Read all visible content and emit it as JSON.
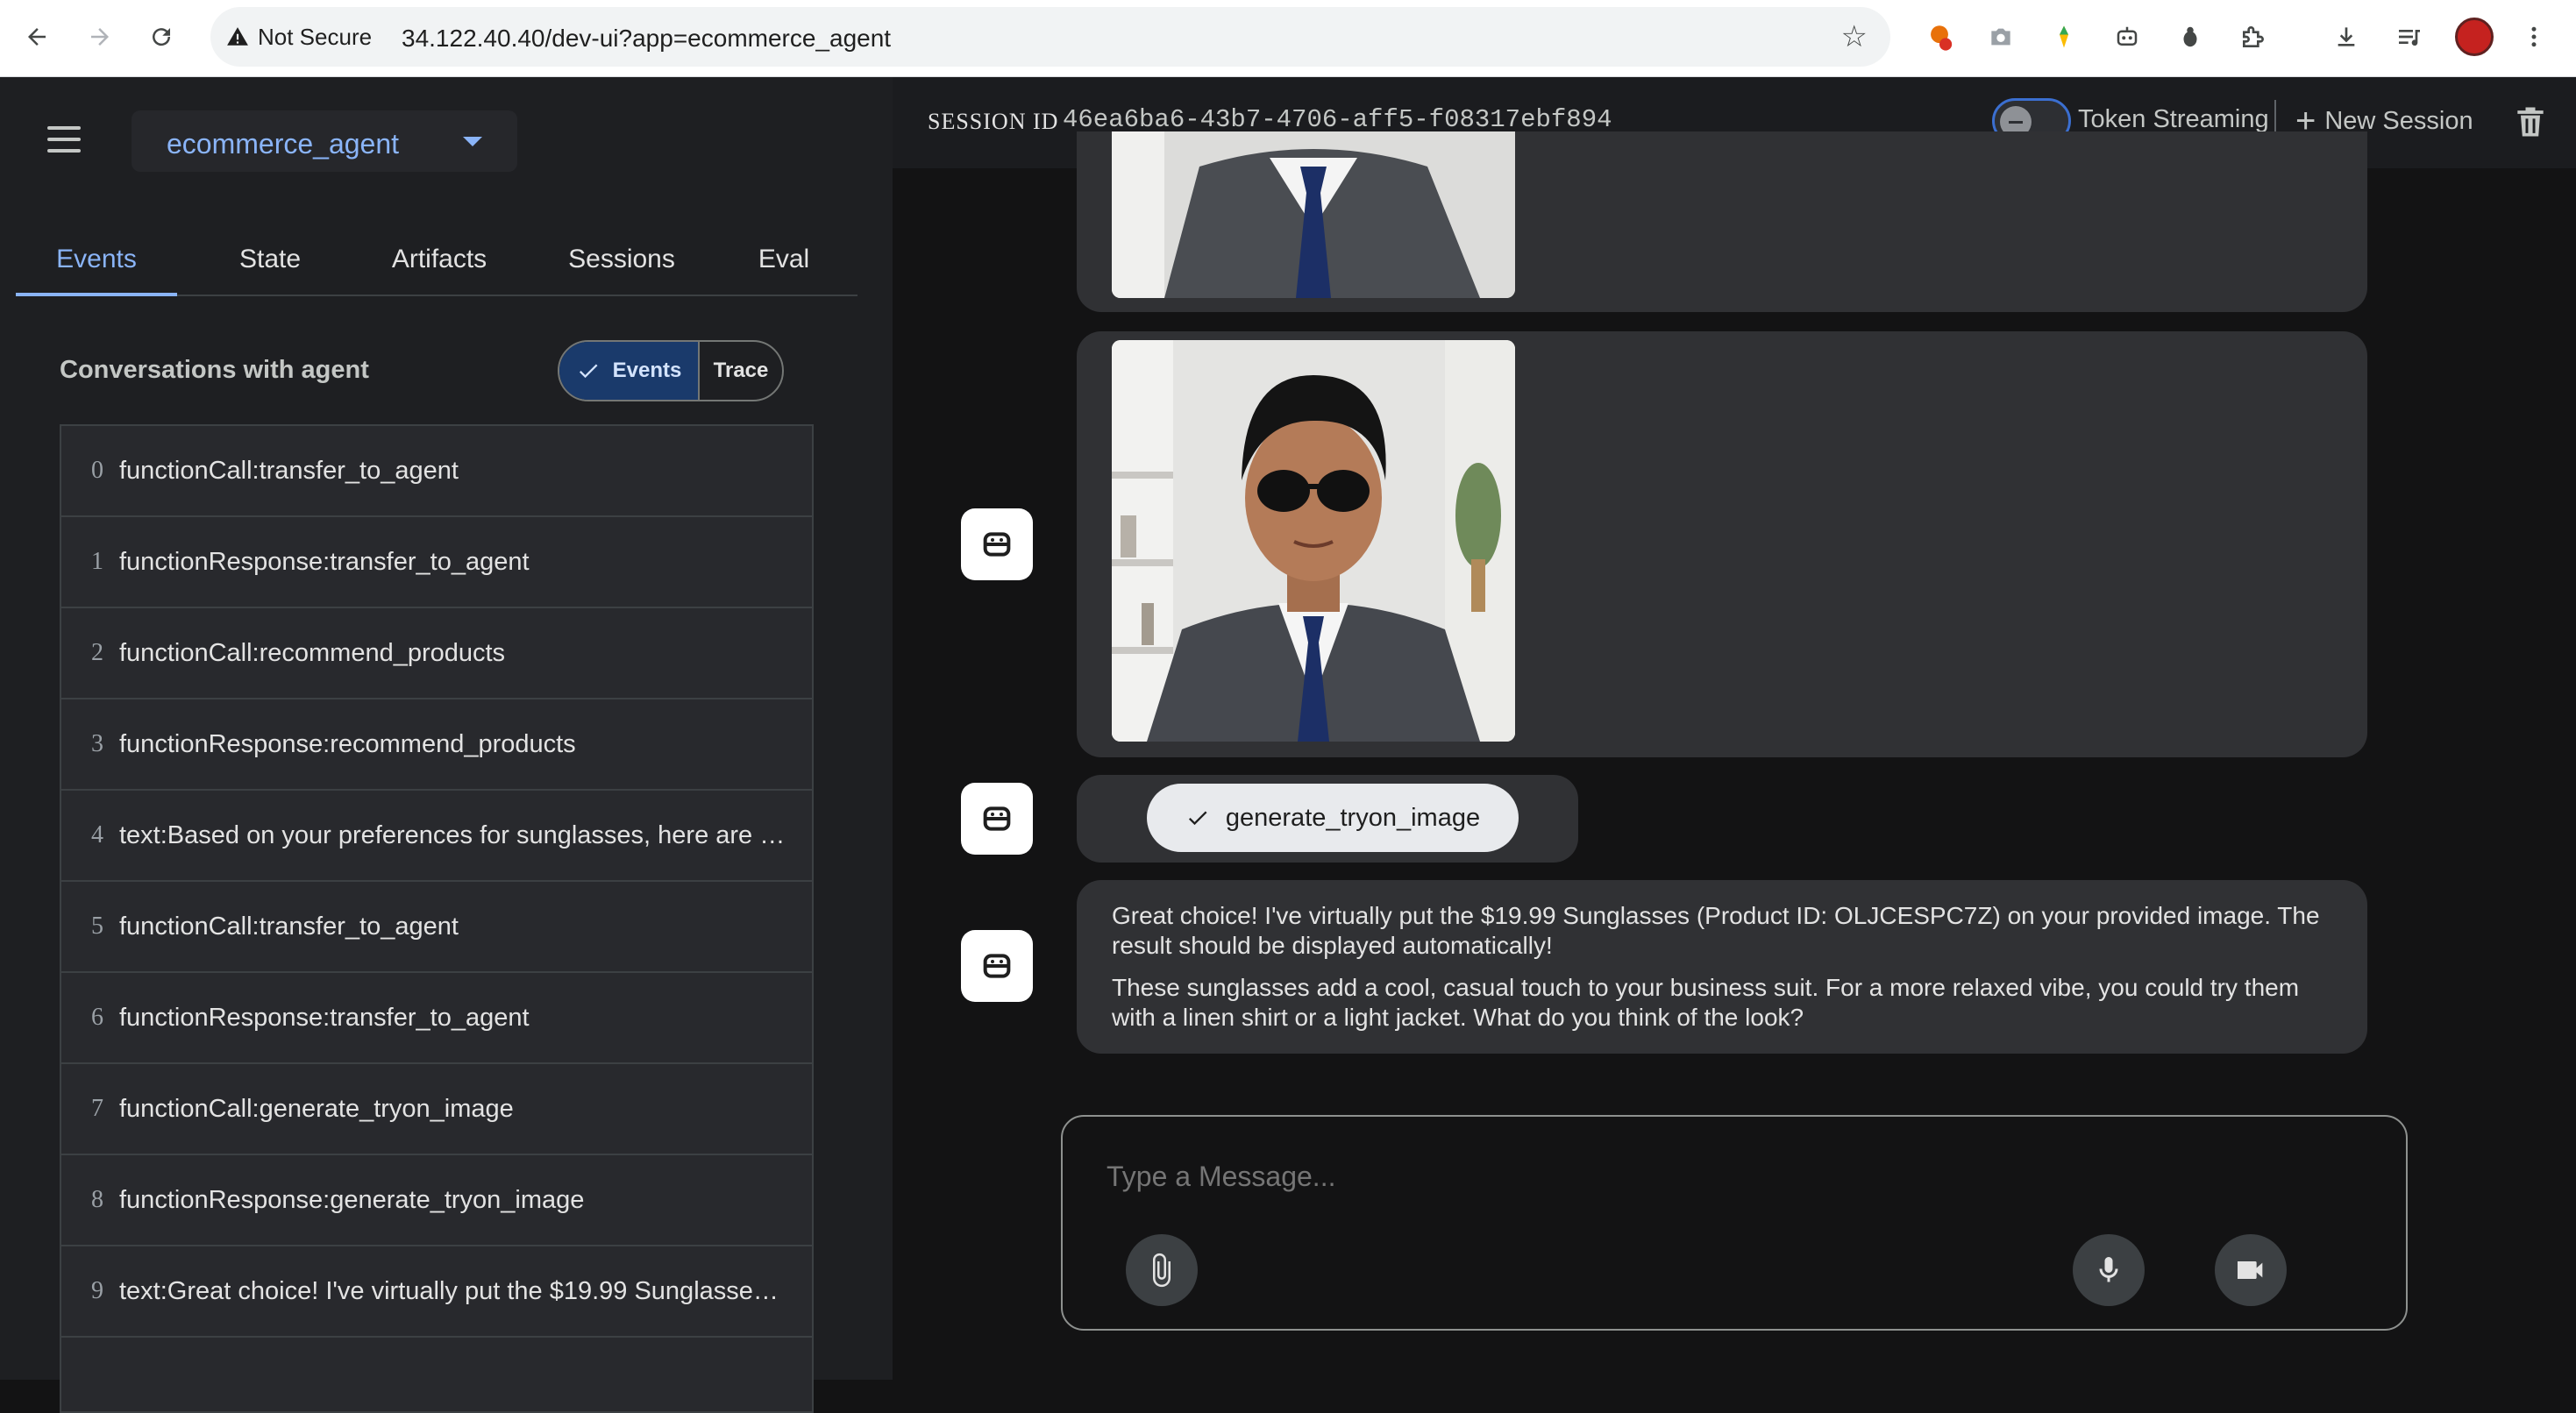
{
  "browser": {
    "security_label": "Not Secure",
    "url": "34.122.40.40/dev-ui?app=ecommerce_agent",
    "back_icon": "arrow-left-icon",
    "forward_icon": "arrow-right-icon",
    "reload_icon": "reload-icon"
  },
  "sidebar": {
    "app_name": "ecommerce_agent",
    "tabs": [
      "Events",
      "State",
      "Artifacts",
      "Sessions",
      "Eval"
    ],
    "active_tab": "Events",
    "conversations_title": "Conversations with agent",
    "toggle": {
      "events_label": "Events",
      "trace_label": "Trace",
      "selected": "Events"
    },
    "events": [
      {
        "index": "0",
        "text": "functionCall:transfer_to_agent"
      },
      {
        "index": "1",
        "text": "functionResponse:transfer_to_agent"
      },
      {
        "index": "2",
        "text": "functionCall:recommend_products"
      },
      {
        "index": "3",
        "text": "functionResponse:recommend_products"
      },
      {
        "index": "4",
        "text": "text:Based on your preferences for sunglasses, here are m..."
      },
      {
        "index": "5",
        "text": "functionCall:transfer_to_agent"
      },
      {
        "index": "6",
        "text": "functionResponse:transfer_to_agent"
      },
      {
        "index": "7",
        "text": "functionCall:generate_tryon_image"
      },
      {
        "index": "8",
        "text": "functionResponse:generate_tryon_image"
      },
      {
        "index": "9",
        "text": "text:Great choice! I've virtually put the $19.99 Sunglasses ..."
      }
    ]
  },
  "header": {
    "session_label": "SESSION ID",
    "session_id": "46ea6ba6-43b7-4706-aff5-f08317ebf894",
    "token_streaming_label": "Token Streaming",
    "token_streaming_on": false,
    "new_session_label": "New Session"
  },
  "chat": {
    "tool_chip_label": "generate_tryon_image",
    "message_paragraph_1": "Great choice! I've virtually put the $19.99 Sunglasses (Product ID: OLJCESPC7Z) on your provided image. The result should be displayed automatically!",
    "message_paragraph_2": "These sunglasses add a cool, casual touch to your business suit. For a more relaxed vibe, you could try them with a linen shirt or a light jacket. What do you think of the look?"
  },
  "composer": {
    "placeholder": "Type a Message..."
  },
  "colors": {
    "accent": "#8ab4f8",
    "sidebar_bg": "#1e1f22",
    "main_bg": "#131314",
    "bubble_bg": "#303134"
  }
}
